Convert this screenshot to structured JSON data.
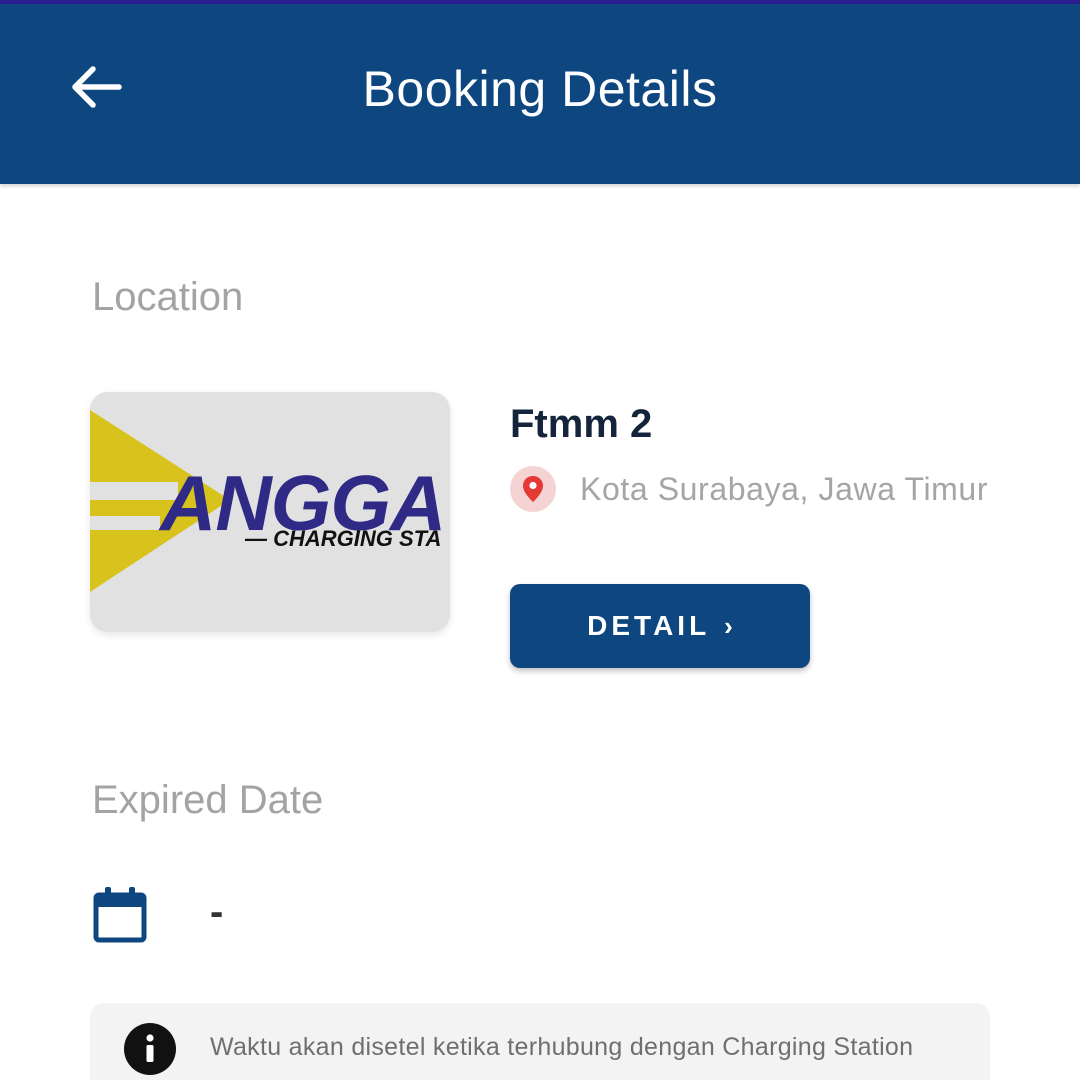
{
  "app_bar": {
    "title": "Booking Details",
    "back_icon": "arrow-left-icon",
    "color": "#0e477f"
  },
  "location": {
    "label": "Location",
    "logo": {
      "word": "ANGGA",
      "subtitle": "— CHARGING STA",
      "colors": {
        "primary": "#2f2a86",
        "accent": "#d8c21c"
      }
    },
    "station_name": "Ftmm 2",
    "pin_icon": "map-pin-icon",
    "address": "Kota Surabaya, Jawa Timur",
    "detail_button": {
      "label": "DETAIL",
      "chevron": "›"
    }
  },
  "expired": {
    "label": "Expired Date",
    "icon": "calendar-icon",
    "value": "-"
  },
  "info": {
    "icon": "info-icon",
    "text": "Waktu akan disetel ketika terhubung dengan Charging Station"
  }
}
